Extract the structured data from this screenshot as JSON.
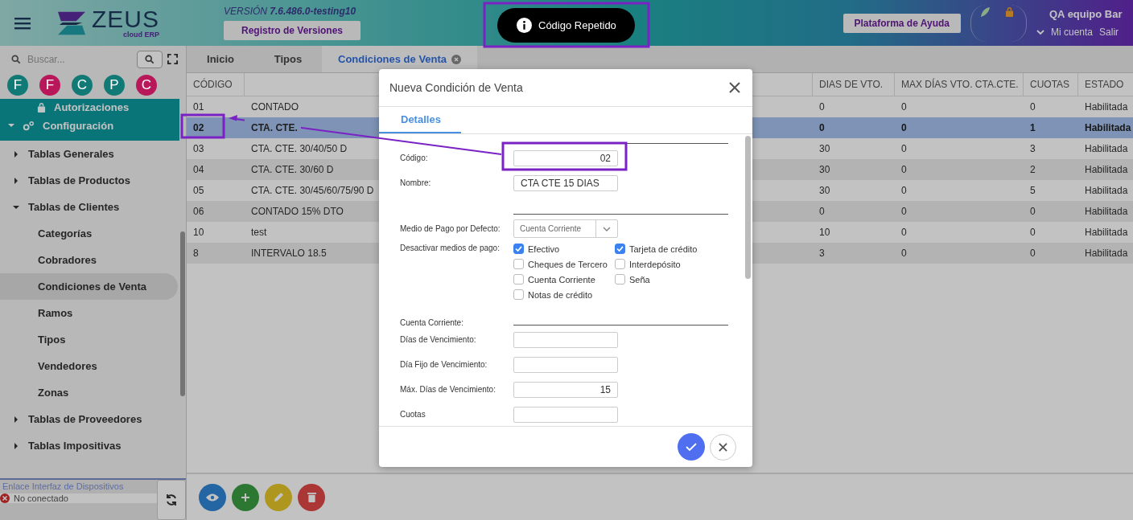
{
  "header": {
    "logo": {
      "name": "ZEUS",
      "tagline": "cloud ERP"
    },
    "version": "VERSIÓN **7.6.486.0-testing10**",
    "versions_button": "Registro de Versiones",
    "help_button": "Plataforma de Ayuda",
    "user": {
      "name": "QA equipo Bar",
      "links": [
        "Mi cuenta",
        "Salir"
      ]
    }
  },
  "toast": {
    "message": "Código Repetido"
  },
  "sidebar": {
    "search": {
      "placeholder": "Buscar..."
    },
    "shortcuts": [
      {
        "letter": "F",
        "color": "#127a76"
      },
      {
        "letter": "F",
        "color": "#b8175a"
      },
      {
        "letter": "C",
        "color": "#127a76"
      },
      {
        "letter": "P",
        "color": "#127a76"
      },
      {
        "letter": "C",
        "color": "#b8175a"
      }
    ],
    "menu": [
      {
        "label": "Autorizaciones"
      },
      {
        "label": "Configuración",
        "expanded": true,
        "children": [
          {
            "label": "Tablas Generales",
            "expanded": false
          },
          {
            "label": "Tablas de Productos",
            "expanded": false
          },
          {
            "label": "Tablas de Clientes",
            "expanded": true,
            "children": [
              {
                "label": "Categorías",
                "selected": false
              },
              {
                "label": "Cobradores",
                "selected": false
              },
              {
                "label": "Condiciones de Venta",
                "selected": true
              },
              {
                "label": "Ramos",
                "selected": false
              },
              {
                "label": "Tipos",
                "selected": false
              },
              {
                "label": "Vendedores",
                "selected": false
              },
              {
                "label": "Zonas",
                "selected": false
              }
            ]
          },
          {
            "label": "Tablas de Proveedores",
            "expanded": false
          },
          {
            "label": "Tablas Impositivas",
            "expanded": false
          }
        ]
      }
    ],
    "device_link": {
      "title": "Enlace Interfaz de Dispositivos",
      "status": "No conectado",
      "connected": false
    }
  },
  "main_tabs": [
    {
      "label": "Inicio",
      "selected": false
    },
    {
      "label": "Tipos",
      "selected": false
    },
    {
      "label": "Condiciones de Venta",
      "selected": true
    }
  ],
  "table": {
    "columns": [
      {
        "label": "CÓDIGO"
      },
      {},
      {
        "label": "DIAS DE VTO."
      },
      {
        "label": "MAX DÍAS VTO. CTA.CTE."
      },
      {
        "label": "CUOTAS"
      },
      {
        "label": "ESTADO"
      }
    ],
    "rows": [
      {
        "cells": [
          "01",
          "CONTADO",
          "0",
          "0",
          "0",
          "Habilitada"
        ],
        "selected": false
      },
      {
        "cells": [
          "02",
          "CTA. CTE.",
          "0",
          "0",
          "1",
          "Habilitada"
        ],
        "selected": true
      },
      {
        "cells": [
          "03",
          "CTA. CTE. 30/40/50 D",
          "30",
          "0",
          "3",
          "Habilitada"
        ],
        "selected": false
      },
      {
        "cells": [
          "04",
          "CTA. CTE. 30/60 D",
          "30",
          "0",
          "2",
          "Habilitada"
        ],
        "selected": false
      },
      {
        "cells": [
          "05",
          "CTA. CTE. 30/45/60/75/90 D",
          "30",
          "0",
          "5",
          "Habilitada"
        ],
        "selected": false
      },
      {
        "cells": [
          "06",
          "CONTADO 15% DTO",
          "0",
          "0",
          "0",
          "Habilitada"
        ],
        "selected": false
      },
      {
        "cells": [
          "10",
          "test",
          "10",
          "0",
          "0",
          "Habilitada"
        ],
        "selected": false
      },
      {
        "cells": [
          "8",
          "INTERVALO 18.5",
          "3",
          "0",
          "0",
          "Habilitada"
        ],
        "selected": false
      }
    ]
  },
  "modal": {
    "title": "Nueva Condición de Venta",
    "tabs": [
      {
        "label": "Detalles",
        "selected": true
      }
    ],
    "form": [
      {
        "kind": "section"
      },
      {
        "kind": "number",
        "label": "Código:",
        "value": "02"
      },
      {
        "kind": "text",
        "label": "Nombre:",
        "value": "CTA CTE 15 DIAS"
      },
      {
        "kind": "section"
      },
      {
        "kind": "select",
        "label": "Medio de Pago por Defecto:",
        "value": "Cuenta Corriente"
      },
      {
        "kind": "checks",
        "label": "Desactivar medios de pago:",
        "options": [
          {
            "label": "Efectivo",
            "checked": true
          },
          {
            "label": "Tarjeta de crédito",
            "checked": true
          },
          {
            "label": "Cheques de Tercero",
            "checked": false
          },
          {
            "label": "Interdepósito",
            "checked": false
          },
          {
            "label": "Cuenta Corriente",
            "checked": false
          },
          {
            "label": "Seña",
            "checked": false
          },
          {
            "label": "Notas de crédito",
            "checked": false
          }
        ]
      },
      {
        "kind": "section",
        "label": "Cuenta Corriente:"
      },
      {
        "kind": "number",
        "label": "Días de Vencimiento:"
      },
      {
        "kind": "number",
        "label": "Día Fijo de Vencimiento:"
      },
      {
        "kind": "number",
        "label": "Máx. Días de Vencimiento:",
        "value": "15"
      },
      {
        "kind": "number",
        "label": "Cuotas"
      }
    ]
  }
}
